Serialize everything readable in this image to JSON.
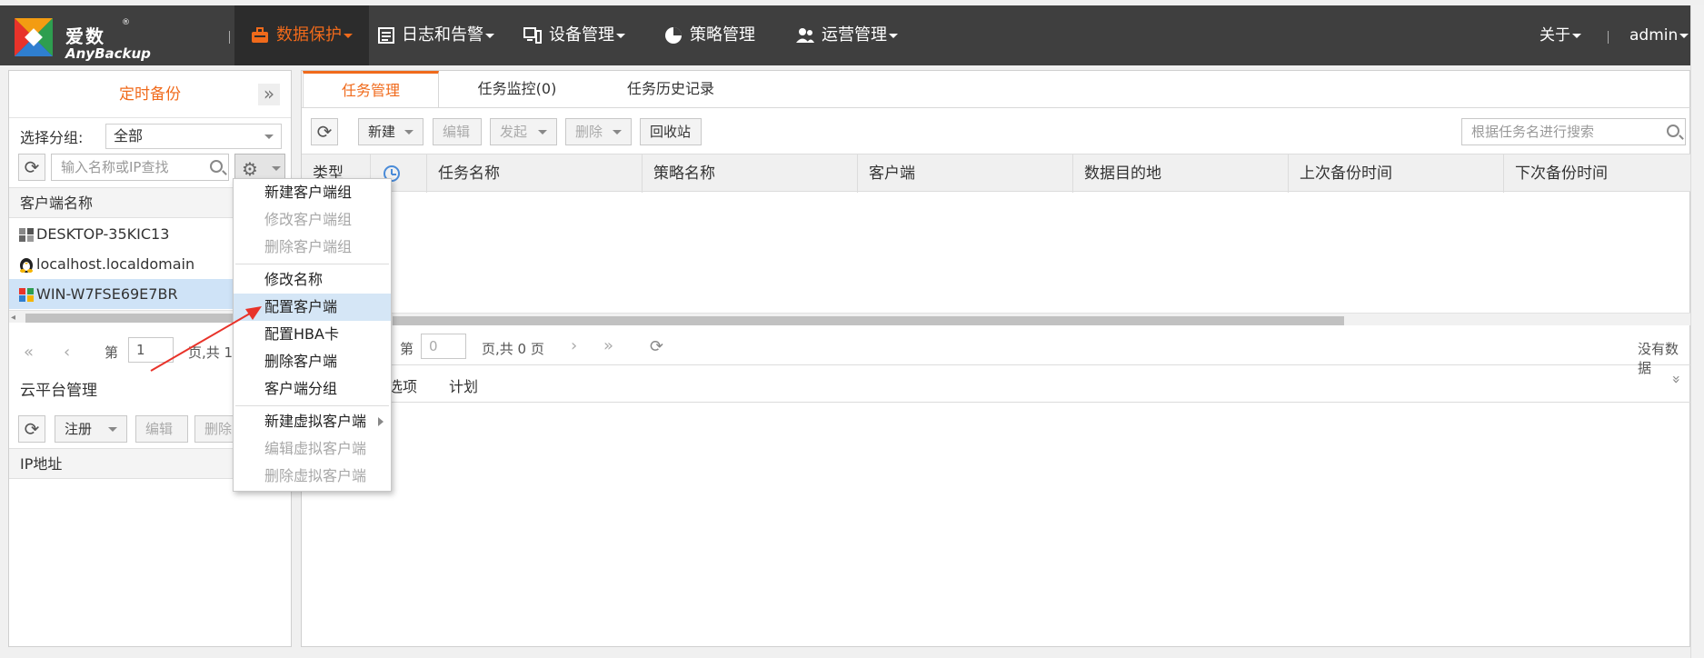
{
  "brand": {
    "name_cn": "爱数",
    "name_en": "AnyBackup",
    "reg": "®"
  },
  "nav": {
    "items": [
      {
        "label": "数据保护",
        "active": true,
        "has_caret": true
      },
      {
        "label": "日志和告警",
        "has_caret": true
      },
      {
        "label": "设备管理",
        "has_caret": true
      },
      {
        "label": "策略管理",
        "has_caret": false
      },
      {
        "label": "运营管理",
        "has_caret": true
      }
    ],
    "about": "关于",
    "user": "admin"
  },
  "left": {
    "title": "定时备份",
    "collapse": "»",
    "group_label": "选择分组:",
    "group_value": "全部",
    "search_placeholder": "输入名称或IP查找",
    "client_header": "客户端名称",
    "clients": [
      {
        "name": "DESKTOP-35KIC13",
        "os": "windows-server"
      },
      {
        "name": "localhost.localdomain",
        "os": "linux"
      },
      {
        "name": "WIN-W7FSE69E7BR",
        "os": "windows",
        "selected": true
      }
    ],
    "pager": {
      "first": "«",
      "prev": "‹",
      "page_label": "第",
      "page_value": "1",
      "total_text": "页,共 1"
    },
    "cloud": {
      "title": "云平台管理",
      "register": "注册",
      "edit": "编辑",
      "delete": "删除",
      "ip_header": "IP地址"
    }
  },
  "context_menu": {
    "items": [
      {
        "label": "新建客户端组",
        "disabled": false
      },
      {
        "label": "修改客户端组",
        "disabled": true
      },
      {
        "label": "删除客户端组",
        "disabled": true
      },
      {
        "label": "修改名称",
        "disabled": false
      },
      {
        "label": "配置客户端",
        "disabled": false,
        "highlight": true
      },
      {
        "label": "配置HBA卡",
        "disabled": false
      },
      {
        "label": "删除客户端",
        "disabled": false
      },
      {
        "label": "客户端分组",
        "disabled": false
      },
      {
        "label": "新建虚拟客户端",
        "disabled": false,
        "submenu": true
      },
      {
        "label": "编辑虚拟客户端",
        "disabled": true
      },
      {
        "label": "删除虚拟客户端",
        "disabled": true
      }
    ]
  },
  "right": {
    "tabs": [
      "任务管理",
      "任务监控(0)",
      "任务历史记录"
    ],
    "toolbar": {
      "new": "新建",
      "edit": "编辑",
      "start": "发起",
      "delete": "删除",
      "recycle": "回收站"
    },
    "search_placeholder": "根据任务名进行搜索",
    "columns": [
      "类型",
      "",
      "任务名称",
      "策略名称",
      "客户端",
      "数据目的地",
      "上次备份时间",
      "下次备份时间"
    ],
    "pager": {
      "page_label": "第",
      "page_value": "0",
      "total_text": "页,共 0 页",
      "empty_text": "没有数据"
    },
    "subtabs": [
      "选项",
      "计划"
    ]
  },
  "colors": {
    "accent": "#f06a1b",
    "topbar": "#3f3f3f",
    "selected_row": "#cfe3f7",
    "arrow": "#e8332a"
  }
}
